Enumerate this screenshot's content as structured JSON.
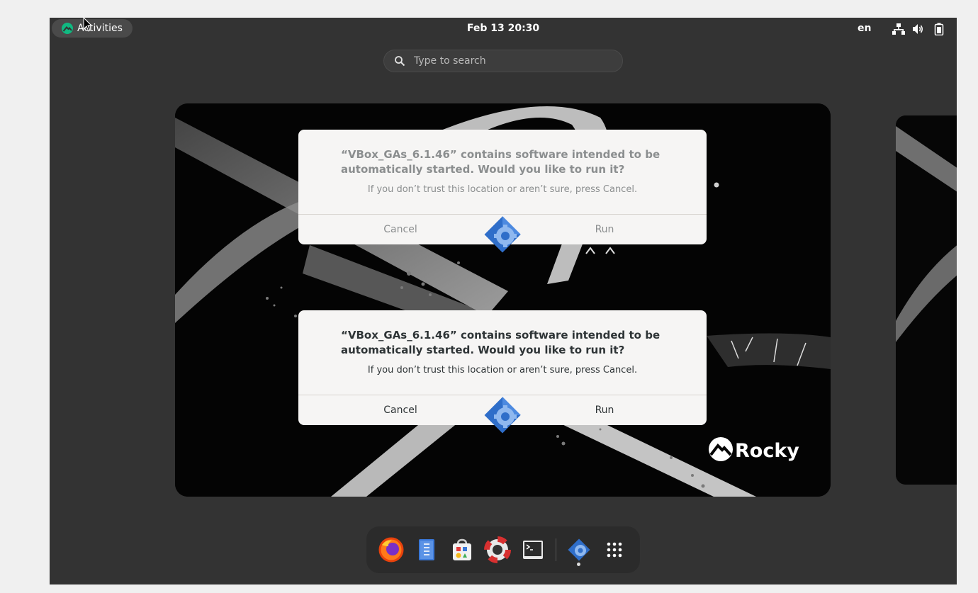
{
  "topbar": {
    "activities_label": "Activities",
    "clock": "Feb 13  20:30",
    "language": "en",
    "tray_icons": [
      "network-icon",
      "volume-icon",
      "battery-icon"
    ]
  },
  "search": {
    "placeholder": "Type to search"
  },
  "dialogs": [
    {
      "state": "inactive",
      "title": "“VBox_GAs_6.1.46” contains software intended to be automatically started. Would you like to run it?",
      "message": "If you don’t trust this location or aren’t sure, press Cancel.",
      "cancel_label": "Cancel",
      "run_label": "Run"
    },
    {
      "state": "active",
      "title": "“VBox_GAs_6.1.46” contains software intended to be automatically started. Would you like to run it?",
      "message": "If you don’t trust this location or aren’t sure, press Cancel.",
      "cancel_label": "Cancel",
      "run_label": "Run"
    }
  ],
  "wallpaper": {
    "brand": "Rocky"
  },
  "dash": {
    "apps": [
      "firefox-icon",
      "text-editor-icon",
      "software-icon",
      "help-icon",
      "terminal-icon",
      "autorun-icon",
      "show-apps-icon"
    ]
  },
  "colors": {
    "shell_bg": "#333333",
    "dialog_bg": "#f6f5f4",
    "accent_blue": "#3d7ad6",
    "rocky_green": "#10b981"
  }
}
